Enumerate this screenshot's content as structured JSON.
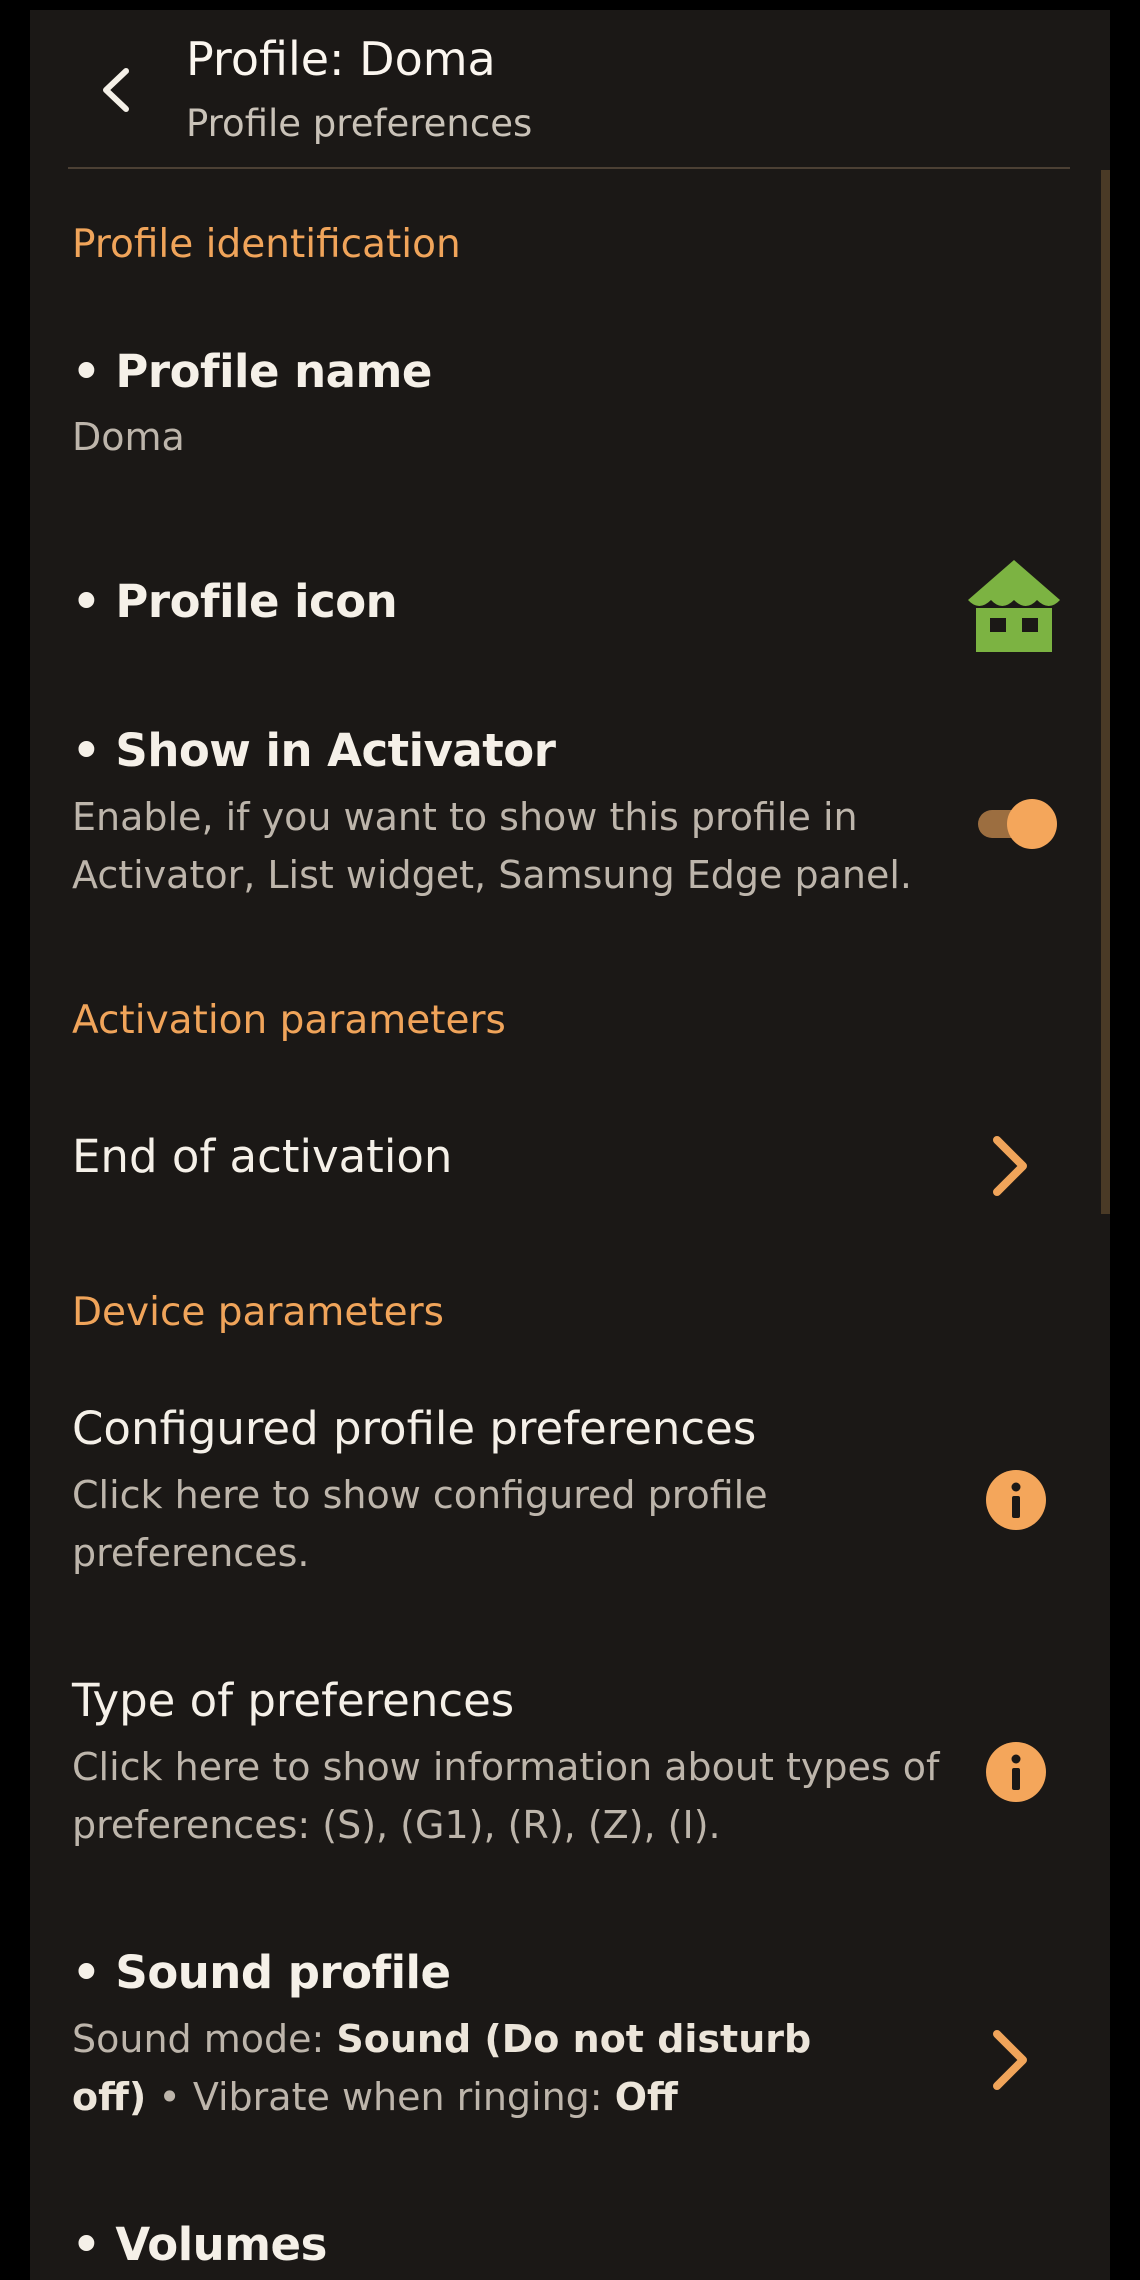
{
  "header": {
    "title": "Profile: Doma",
    "subtitle": "Profile preferences"
  },
  "sections": {
    "identification": "Profile identification",
    "activation": "Activation parameters",
    "device": "Device parameters"
  },
  "profile_name": {
    "title": "• Profile name",
    "value": "Doma"
  },
  "profile_icon": {
    "title": "• Profile icon",
    "icon": "house-icon",
    "icon_color": "#7cb342"
  },
  "show_in_activator": {
    "title": "• Show in Activator",
    "description": "Enable, if you want to show this profile in Activator, List widget, Samsung Edge panel.",
    "enabled": true
  },
  "end_of_activation": {
    "title": "End of activation"
  },
  "configured_prefs": {
    "title": "Configured profile preferences",
    "description": "Click here to show configured profile preferences."
  },
  "type_of_prefs": {
    "title": "Type of preferences",
    "description": "Click here to show information about types of preferences: (S), (G1), (R), (Z), (I)."
  },
  "sound_profile": {
    "title": "• Sound profile",
    "mode_label": "Sound mode: ",
    "mode_value": "Sound (Do not disturb off)",
    "separator": " • ",
    "vibrate_label": "Vibrate when ringing: ",
    "vibrate_value": "Off"
  },
  "volumes": {
    "title": "• Volumes"
  },
  "colors": {
    "accent": "#f0a45a",
    "background": "#1b1816",
    "icon_green": "#7cb342"
  }
}
